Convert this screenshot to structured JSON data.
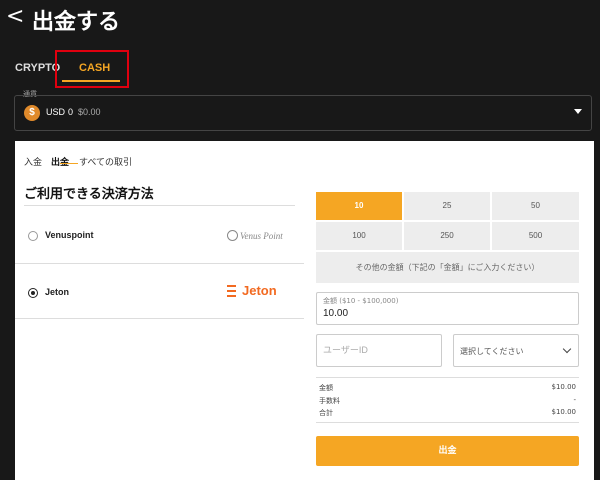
{
  "header": {
    "back_glyph": "<",
    "title": "出金する"
  },
  "tabs": [
    {
      "label": "CRYPTO",
      "active": false
    },
    {
      "label": "CASH",
      "active": true
    }
  ],
  "currency": {
    "label": "通貨",
    "icon": "dollar-coin-icon",
    "code": "USD",
    "balance": "0",
    "amount": "$0.00"
  },
  "subtabs": [
    "入金",
    "出金",
    "すべての取引"
  ],
  "methods": {
    "title": "ご利用できる決済方法",
    "items": [
      {
        "name": "Venuspoint",
        "logo_text": "Venus Point",
        "selected": false
      },
      {
        "name": "Jeton",
        "logo_text": "Jeton",
        "selected": true
      }
    ]
  },
  "amounts": {
    "options": [
      "10",
      "25",
      "50",
      "100",
      "250",
      "500"
    ],
    "selected": "10",
    "other_label": "その他の金額（下記の「金額」にご入力ください）"
  },
  "amount_field": {
    "label": "金額 ($10 - $100,000)",
    "value": "10.00"
  },
  "user_field": {
    "placeholder": "ユーザーID"
  },
  "select_field": {
    "value": "選択してください"
  },
  "summary": {
    "rows": [
      {
        "label": "金額",
        "value": "$10.00"
      },
      {
        "label": "手数料",
        "value": "-"
      },
      {
        "label": "合計",
        "value": "$10.00"
      }
    ]
  },
  "submit": {
    "label": "出金"
  },
  "colors": {
    "accent": "#f5a623",
    "jeton": "#f26a21",
    "highlight": "#e0000f",
    "background": "#181818"
  }
}
